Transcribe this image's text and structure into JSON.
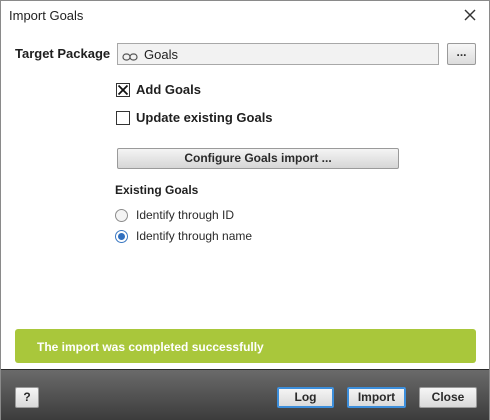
{
  "window": {
    "title": "Import Goals"
  },
  "target_package": {
    "label": "Target Package",
    "value": "Goals",
    "browse_label": "..."
  },
  "options": {
    "add_goals": {
      "label": "Add Goals",
      "checked": true
    },
    "update_existing": {
      "label": "Update existing Goals",
      "checked": false
    }
  },
  "configure_button": "Configure Goals import ...",
  "existing_goals": {
    "heading": "Existing Goals",
    "options": [
      {
        "label": "Identify through ID",
        "selected": false
      },
      {
        "label": "Identify through name",
        "selected": true
      }
    ]
  },
  "status": {
    "message": "The import was completed successfully",
    "color": "#a9c73b"
  },
  "footer": {
    "help_label": "?",
    "log_label": "Log",
    "import_label": "Import",
    "close_label": "Close"
  }
}
